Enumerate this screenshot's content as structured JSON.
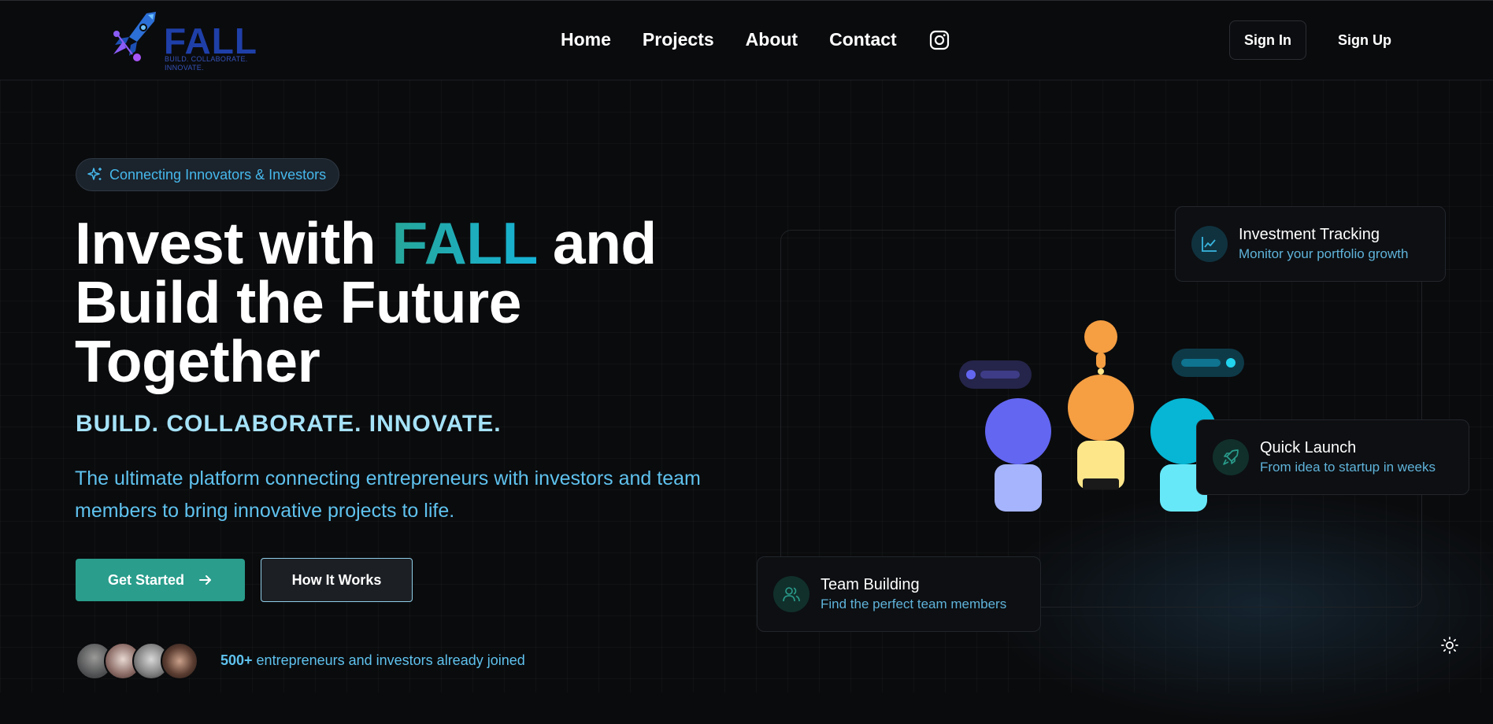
{
  "brand": {
    "name": "FALL",
    "tagline": "BUILD. COLLABORATE. INNOVATE."
  },
  "nav": {
    "items": [
      "Home",
      "Projects",
      "About",
      "Contact"
    ]
  },
  "auth": {
    "sign_in": "Sign In",
    "sign_up": "Sign Up"
  },
  "hero": {
    "badge": "Connecting Innovators & Investors",
    "headline_prefix": "Invest with ",
    "headline_accent": "FALL",
    "headline_suffix": " and",
    "headline_line2": "Build the Future",
    "headline_line3": "Together",
    "tagline": "BUILD. COLLABORATE. INNOVATE.",
    "description": "The ultimate platform connecting entrepreneurs with investors and team members to bring innovative projects to life.",
    "primary_cta": "Get Started",
    "secondary_cta": "How It Works",
    "joined_count": "500+",
    "joined_text": " entrepreneurs and investors already joined"
  },
  "features": [
    {
      "title": "Investment Tracking",
      "subtitle": "Monitor your portfolio growth",
      "icon": "chart-line-icon"
    },
    {
      "title": "Quick Launch",
      "subtitle": "From idea to startup in weeks",
      "icon": "rocket-icon"
    },
    {
      "title": "Team Building",
      "subtitle": "Find the perfect team members",
      "icon": "users-icon"
    }
  ],
  "colors": {
    "accent_teal": "#2a9d8c",
    "accent_cyan": "#46b8ec",
    "background": "#0a0b0d",
    "figure_purple": "#6366f1",
    "figure_orange": "#f59e42",
    "figure_cyan": "#06b6d4"
  }
}
